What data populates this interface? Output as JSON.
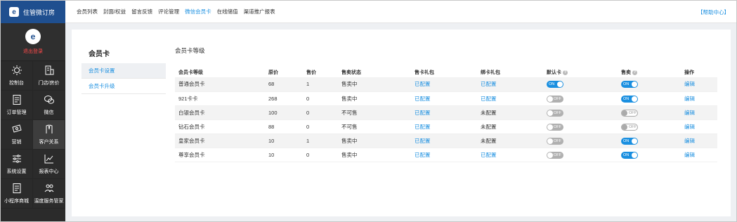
{
  "app": {
    "brand_name": "住管微订房",
    "logout_label": "退出登录"
  },
  "nav": [
    {
      "label": "控制台",
      "icon": "gear-icon"
    },
    {
      "label": "门店/房价",
      "icon": "building-icon"
    },
    {
      "label": "订单管理",
      "icon": "document-icon"
    },
    {
      "label": "微信",
      "icon": "wechat-icon"
    },
    {
      "label": "营销",
      "icon": "ticket-icon"
    },
    {
      "label": "客户关系",
      "icon": "customer-icon",
      "active": true
    },
    {
      "label": "系统设置",
      "icon": "sliders-icon"
    },
    {
      "label": "报表中心",
      "icon": "chart-icon"
    },
    {
      "label": "小程序商城",
      "icon": "document-icon"
    },
    {
      "label": "温度服务管家",
      "icon": "people-icon"
    }
  ],
  "topbar": {
    "tabs": [
      "会员列表",
      "封面/权益",
      "留言反馈",
      "评论管理",
      "微信会员卡",
      "在线储值",
      "渠道推广报表"
    ],
    "active_index": 4,
    "help": "【帮助中心】"
  },
  "subnav": {
    "title": "会员卡",
    "items": [
      "会员卡设置",
      "会员卡升级"
    ],
    "active_index": 0
  },
  "main": {
    "title": "会员卡等级",
    "columns": [
      "会员卡等级",
      "原价",
      "售价",
      "售卖状态",
      "售卡礼包",
      "绑卡礼包",
      "默认卡",
      "售卖",
      "操作"
    ],
    "toggle_on": "ON",
    "toggle_off": "OFF",
    "rows": [
      {
        "level": "普通会员卡",
        "original": "68",
        "price": "1",
        "status": "售卖中",
        "sale_gift": "已配置",
        "bind_gift": "已配置",
        "bind_link": true,
        "default_on": true,
        "sell_on": true,
        "sell_white": false,
        "action": "编辑"
      },
      {
        "level": "921卡卡",
        "original": "268",
        "price": "0",
        "status": "售卖中",
        "sale_gift": "已配置",
        "bind_gift": "已配置",
        "bind_link": true,
        "default_on": false,
        "sell_on": true,
        "sell_white": false,
        "action": "编辑"
      },
      {
        "level": "白银会员卡",
        "original": "100",
        "price": "0",
        "status": "不可售",
        "sale_gift": "已配置",
        "bind_gift": "未配置",
        "bind_link": false,
        "default_on": false,
        "sell_on": false,
        "sell_white": true,
        "action": "编辑"
      },
      {
        "level": "钻石会员卡",
        "original": "88",
        "price": "0",
        "status": "不可售",
        "sale_gift": "已配置",
        "bind_gift": "未配置",
        "bind_link": false,
        "default_on": false,
        "sell_on": false,
        "sell_white": true,
        "action": "编辑"
      },
      {
        "level": "皇家会员卡",
        "original": "10",
        "price": "1",
        "status": "售卖中",
        "sale_gift": "已配置",
        "bind_gift": "未配置",
        "bind_link": false,
        "default_on": false,
        "sell_on": true,
        "sell_white": false,
        "action": "编辑"
      },
      {
        "level": "尊享会员卡",
        "original": "10",
        "price": "0",
        "status": "售卖中",
        "sale_gift": "已配置",
        "bind_gift": "已配置",
        "bind_link": true,
        "default_on": false,
        "sell_on": true,
        "sell_white": false,
        "action": "编辑"
      }
    ]
  }
}
